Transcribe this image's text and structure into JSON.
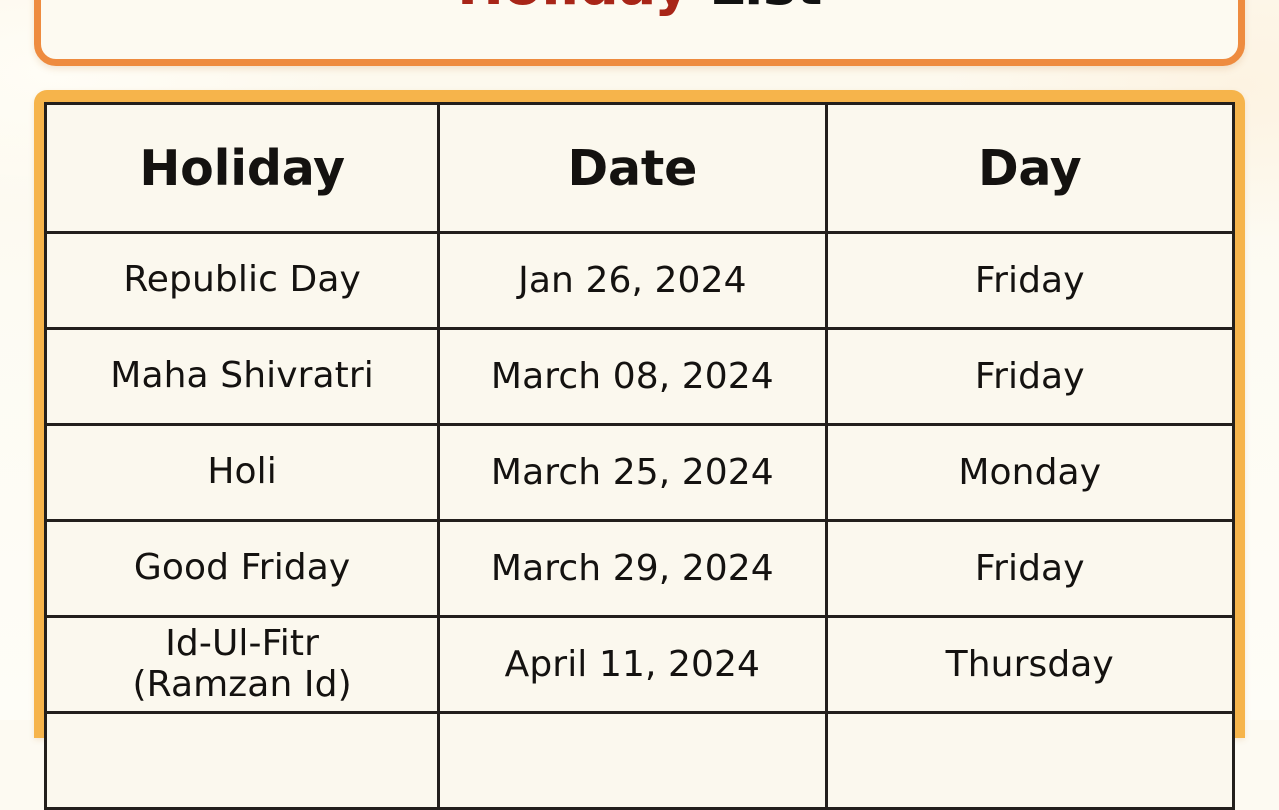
{
  "title": {
    "part_red": "Holiday",
    "part_black": " List"
  },
  "colors": {
    "title_border": "#ee8b3f",
    "table_frame": "#f6b44b",
    "cell_background": "#fbf8ee",
    "grid_line": "#231f1c",
    "title_red": "#a82518",
    "title_black": "#111111",
    "page_background": "#fdfaf2"
  },
  "table": {
    "columns": [
      "Holiday",
      "Date",
      "Day"
    ],
    "rows": [
      {
        "holiday": "Republic Day",
        "holiday_line2": "",
        "date": "Jan 26, 2024",
        "day": "Friday"
      },
      {
        "holiday": "Maha Shivratri",
        "holiday_line2": "",
        "date": "March 08, 2024",
        "day": "Friday"
      },
      {
        "holiday": "Holi",
        "holiday_line2": "",
        "date": "March 25, 2024",
        "day": "Monday"
      },
      {
        "holiday": "Good Friday",
        "holiday_line2": "",
        "date": "March 29, 2024",
        "day": "Friday"
      },
      {
        "holiday": "Id-Ul-Fitr",
        "holiday_line2": "(Ramzan Id)",
        "date": "April 11, 2024",
        "day": "Thursday"
      },
      {
        "holiday": "",
        "holiday_line2": "",
        "date": "",
        "day": ""
      }
    ]
  }
}
